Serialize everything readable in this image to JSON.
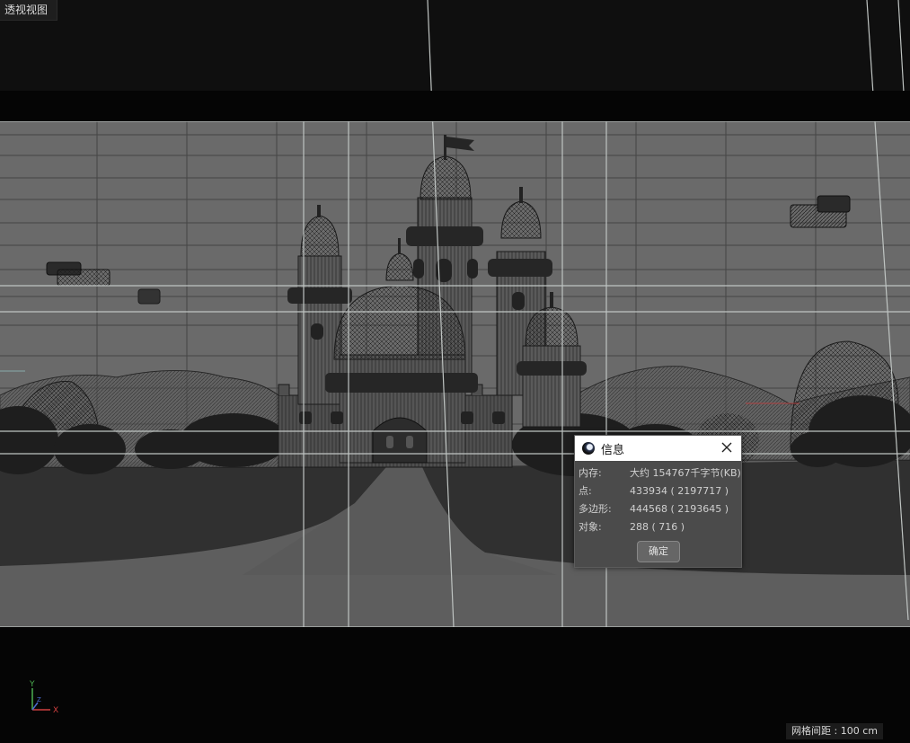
{
  "viewport": {
    "label": "透视视图",
    "grid_spacing": "网格间距 : 100 cm"
  },
  "axis": {
    "y_label": "Y",
    "z_label": "Z",
    "x_label": "X"
  },
  "dialog": {
    "title": "信息",
    "rows": [
      {
        "key": "内存:",
        "value": "大约 154767千字节(KB)"
      },
      {
        "key": "点:",
        "value": "433934 ( 2197717 )"
      },
      {
        "key": "多边形:",
        "value": "444568 ( 2193645 )"
      },
      {
        "key": "对象:",
        "value": "288 ( 716 )"
      }
    ],
    "ok_label": "确定"
  },
  "colors": {
    "sky": "#6b6b6b",
    "ground": "#333333",
    "wire": "#1a1a1a",
    "grid": "#4a4a4a"
  }
}
